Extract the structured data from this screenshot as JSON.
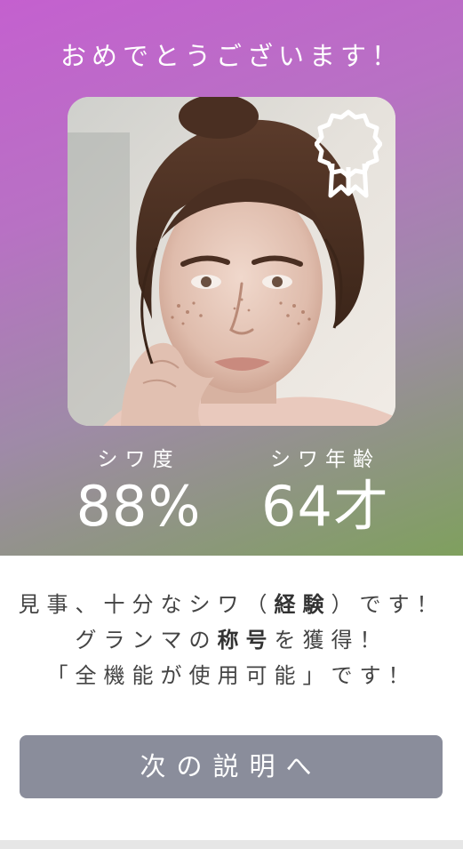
{
  "header": {
    "congrats": "おめでとうございます！"
  },
  "photo": {
    "award_icon": "award-ribbon-icon"
  },
  "stats": {
    "wrinkle_degree": {
      "label": "シワ度",
      "value": "88%"
    },
    "wrinkle_age": {
      "label": "シワ年齢",
      "value": "64才"
    }
  },
  "message": {
    "line1_pre": "見事、十分なシワ（",
    "line1_bold": "経験",
    "line1_post": "）です！",
    "line2_pre": "グランマの",
    "line2_bold": "称号",
    "line2_post": "を獲得！",
    "line3": "「全機能が使用可能」です！"
  },
  "actions": {
    "next_label": "次の説明へ"
  },
  "colors": {
    "gradient_start": "#c460cf",
    "gradient_end": "#7fa05e",
    "button_bg": "#8a8d9b"
  }
}
